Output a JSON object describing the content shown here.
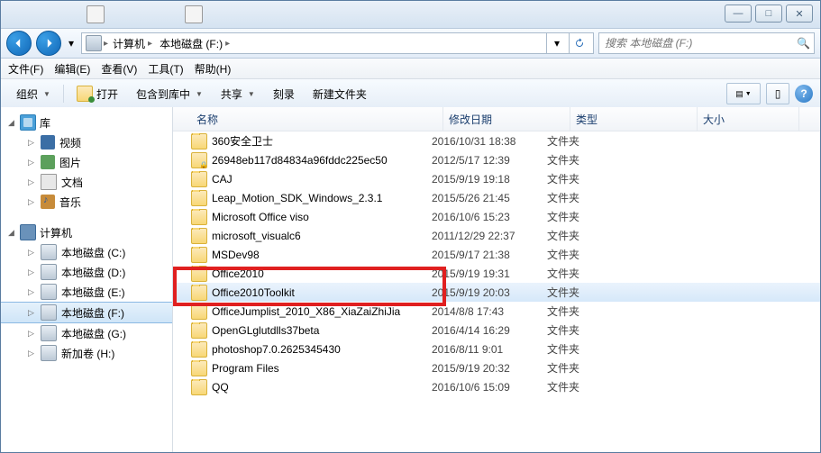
{
  "window_controls": {
    "min": "—",
    "max": "□",
    "close": "✕"
  },
  "breadcrumbs": [
    {
      "label": "计算机"
    },
    {
      "label": "本地磁盘 (F:)"
    }
  ],
  "search_placeholder": "搜索 本地磁盘 (F:)",
  "menubar": [
    {
      "id": "file",
      "label": "文件(F)"
    },
    {
      "id": "edit",
      "label": "编辑(E)"
    },
    {
      "id": "view",
      "label": "查看(V)"
    },
    {
      "id": "tools",
      "label": "工具(T)"
    },
    {
      "id": "help",
      "label": "帮助(H)"
    }
  ],
  "toolbar": {
    "organize": "组织",
    "open": "打开",
    "include": "包含到库中",
    "share": "共享",
    "burn": "刻录",
    "newfolder": "新建文件夹"
  },
  "sidebar": {
    "libraries": {
      "head": "库",
      "items": [
        {
          "id": "videos",
          "label": "视频",
          "ic": "ic-vid"
        },
        {
          "id": "pictures",
          "label": "图片",
          "ic": "ic-img"
        },
        {
          "id": "documents",
          "label": "文档",
          "ic": "ic-doc"
        },
        {
          "id": "music",
          "label": "音乐",
          "ic": "ic-mus"
        }
      ]
    },
    "computer": {
      "head": "计算机",
      "items": [
        {
          "id": "c",
          "label": "本地磁盘 (C:)",
          "ic": "ic-hd",
          "sel": false
        },
        {
          "id": "d",
          "label": "本地磁盘 (D:)",
          "ic": "ic-hd",
          "sel": false
        },
        {
          "id": "e",
          "label": "本地磁盘 (E:)",
          "ic": "ic-hd",
          "sel": false
        },
        {
          "id": "f",
          "label": "本地磁盘 (F:)",
          "ic": "ic-hd",
          "sel": true
        },
        {
          "id": "g",
          "label": "本地磁盘 (G:)",
          "ic": "ic-hd",
          "sel": false
        },
        {
          "id": "h",
          "label": "新加卷 (H:)",
          "ic": "ic-hd",
          "sel": false
        }
      ]
    }
  },
  "columns": {
    "name": "名称",
    "date": "修改日期",
    "type": "类型",
    "size": "大小"
  },
  "files": [
    {
      "name": "360安全卫士",
      "date": "2016/10/31 18:38",
      "type": "文件夹",
      "ic": "ic-fold",
      "sel": false
    },
    {
      "name": "26948eb117d84834a96fddc225ec50",
      "date": "2012/5/17 12:39",
      "type": "文件夹",
      "ic": "ic-foldlock",
      "sel": false
    },
    {
      "name": "CAJ",
      "date": "2015/9/19 19:18",
      "type": "文件夹",
      "ic": "ic-fold",
      "sel": false
    },
    {
      "name": "Leap_Motion_SDK_Windows_2.3.1",
      "date": "2015/5/26 21:45",
      "type": "文件夹",
      "ic": "ic-fold",
      "sel": false
    },
    {
      "name": "Microsoft Office viso",
      "date": "2016/10/6 15:23",
      "type": "文件夹",
      "ic": "ic-fold",
      "sel": false
    },
    {
      "name": "microsoft_visualc6",
      "date": "2011/12/29 22:37",
      "type": "文件夹",
      "ic": "ic-fold",
      "sel": false
    },
    {
      "name": "MSDev98",
      "date": "2015/9/17 21:38",
      "type": "文件夹",
      "ic": "ic-fold",
      "sel": false
    },
    {
      "name": "Office2010",
      "date": "2015/9/19 19:31",
      "type": "文件夹",
      "ic": "ic-fold",
      "sel": false
    },
    {
      "name": "Office2010Toolkit",
      "date": "2015/9/19 20:03",
      "type": "文件夹",
      "ic": "ic-fold",
      "sel": true,
      "hl": true
    },
    {
      "name": "OfficeJumplist_2010_X86_XiaZaiZhiJia",
      "date": "2014/8/8 17:43",
      "type": "文件夹",
      "ic": "ic-fold",
      "sel": false
    },
    {
      "name": "OpenGLglutdlls37beta",
      "date": "2016/4/14 16:29",
      "type": "文件夹",
      "ic": "ic-fold",
      "sel": false
    },
    {
      "name": "photoshop7.0.2625345430",
      "date": "2016/8/11 9:01",
      "type": "文件夹",
      "ic": "ic-fold",
      "sel": false
    },
    {
      "name": "Program Files",
      "date": "2015/9/19 20:32",
      "type": "文件夹",
      "ic": "ic-fold",
      "sel": false
    },
    {
      "name": "QQ",
      "date": "2016/10/6 15:09",
      "type": "文件夹",
      "ic": "ic-fold",
      "sel": false
    }
  ]
}
